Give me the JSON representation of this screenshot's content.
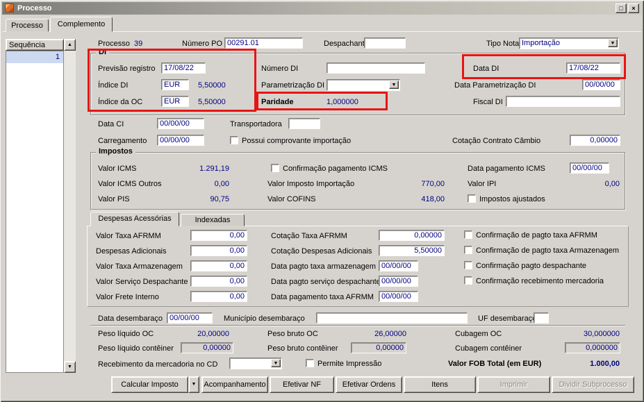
{
  "window": {
    "title": "Processo"
  },
  "icons": {
    "maximize": "□",
    "close": "×",
    "dropdown": "▼",
    "scroll_up": "▲",
    "scroll_down": "▼"
  },
  "tabs": {
    "t0": "Processo",
    "t1": "Complemento"
  },
  "grid": {
    "header": "Sequência",
    "row1": "1"
  },
  "head": {
    "processo_label": "Processo",
    "processo_value": "39",
    "numero_po_label": "Número PO",
    "numero_po_value": "00291.01",
    "despachante_label": "Despachante",
    "despachante_value": "",
    "tipo_nota_label": "Tipo Nota",
    "tipo_nota_value": "Importação"
  },
  "di": {
    "group": "DI",
    "previsao_label": "Previsão registro",
    "previsao_value": "17/08/22",
    "numero_di_label": "Número DI",
    "numero_di_value": "",
    "data_di_label": "Data DI",
    "data_di_value": "17/08/22",
    "indice_di_label": "Índice DI",
    "indice_di_moeda": "EUR",
    "indice_di_value": "5,50000",
    "parametrizacao_label": "Parametrização DI",
    "parametrizacao_value": "",
    "data_param_label": "Data Parametrização DI",
    "data_param_value": "00/00/00",
    "indice_oc_label": "Índice da OC",
    "indice_oc_moeda": "EUR",
    "indice_oc_value": "5,50000",
    "paridade_label": "Paridade",
    "paridade_value": "1,000000",
    "fiscal_label": "Fiscal DI",
    "fiscal_value": ""
  },
  "transporte": {
    "data_ci_label": "Data CI",
    "data_ci_value": "00/00/00",
    "transportadora_label": "Transportadora",
    "transportadora_value": "",
    "carregamento_label": "Carregamento",
    "carregamento_value": "00/00/00",
    "comprovante_label": "Possui comprovante importação",
    "cotacao_label": "Cotação Contrato Câmbio",
    "cotacao_value": "0,00000"
  },
  "impostos": {
    "group": "Impostos",
    "icms_label": "Valor ICMS",
    "icms_value": "1.291,19",
    "conf_icms_label": "Confirmação pagamento ICMS",
    "data_icms_label": "Data pagamento ICMS",
    "data_icms_value": "00/00/00",
    "icms_outros_label": "Valor ICMS Outros",
    "icms_outros_value": "0,00",
    "imp_importacao_label": "Valor Imposto Importação",
    "imp_importacao_value": "770,00",
    "ipi_label": "Valor IPI",
    "ipi_value": "0,00",
    "pis_label": "Valor PIS",
    "pis_value": "90,75",
    "cofins_label": "Valor COFINS",
    "cofins_value": "418,00",
    "ajustados_label": "Impostos ajustados"
  },
  "desp_tabs": {
    "t0": "Despesas Acessórias",
    "t1": "Indexadas"
  },
  "despesas": {
    "afrmm_label": "Valor Taxa AFRMM",
    "afrmm_value": "0,00",
    "cot_afrmm_label": "Cotação Taxa AFRMM",
    "cot_afrmm_value": "0,00000",
    "conf_afrmm_label": "Confirmação de pagto taxa AFRMM",
    "adicionais_label": "Despesas Adicionais",
    "adicionais_value": "0,00",
    "cot_adicionais_label": "Cotação Despesas Adicionais",
    "cot_adicionais_value": "5,50000",
    "conf_armazenagem_label": "Confirmação de pagto taxa Armazenagem",
    "armazenagem_label": "Valor Taxa Armazenagem",
    "armazenagem_value": "0,00",
    "data_armazenagem_label": "Data pagto taxa armazenagem",
    "data_armazenagem_value": "00/00/00",
    "conf_despachante_label": "Confirmação pagto despachante",
    "servico_label": "Valor Serviço Despachante",
    "servico_value": "0,00",
    "data_servico_label": "Data pagto serviço despachante",
    "data_servico_value": "00/00/00",
    "conf_recebimento_label": "Confirmação recebimento mercadoria",
    "frete_label": "Valor Frete Interno",
    "frete_value": "0,00",
    "data_afrmm_label": "Data pagamento taxa AFRMM",
    "data_afrmm_value": "00/00/00"
  },
  "desembaraco": {
    "data_label": "Data desembaraço",
    "data_value": "00/00/00",
    "municipio_label": "Município desembaraço",
    "municipio_value": "",
    "uf_label": "UF desembaraço",
    "uf_value": ""
  },
  "pesos": {
    "liquido_oc_label": "Peso líquido OC",
    "liquido_oc_value": "20,00000",
    "bruto_oc_label": "Peso bruto OC",
    "bruto_oc_value": "26,00000",
    "cubagem_oc_label": "Cubagem OC",
    "cubagem_oc_value": "30,000000",
    "liquido_cont_label": "Peso líquido contêiner",
    "liquido_cont_value": "0,00000",
    "bruto_cont_label": "Peso bruto contêiner",
    "bruto_cont_value": "0,00000",
    "cubagem_cont_label": "Cubagem contêiner",
    "cubagem_cont_value": "0,000000"
  },
  "footer": {
    "recebimento_label": "Recebimento da mercadoria no CD",
    "recebimento_value": "",
    "permite_label": "Permite Impressão",
    "fob_label": "Valor FOB Total (em EUR)",
    "fob_value": "1.000,00"
  },
  "buttons": {
    "b1": "Calcular Imposto",
    "b2": "Acompanhamento",
    "b3": "Efetivar NF",
    "b4": "Efetivar Ordens",
    "b5": "Itens",
    "b6": "Imprimir",
    "b7": "Dividir Subprocesso"
  }
}
